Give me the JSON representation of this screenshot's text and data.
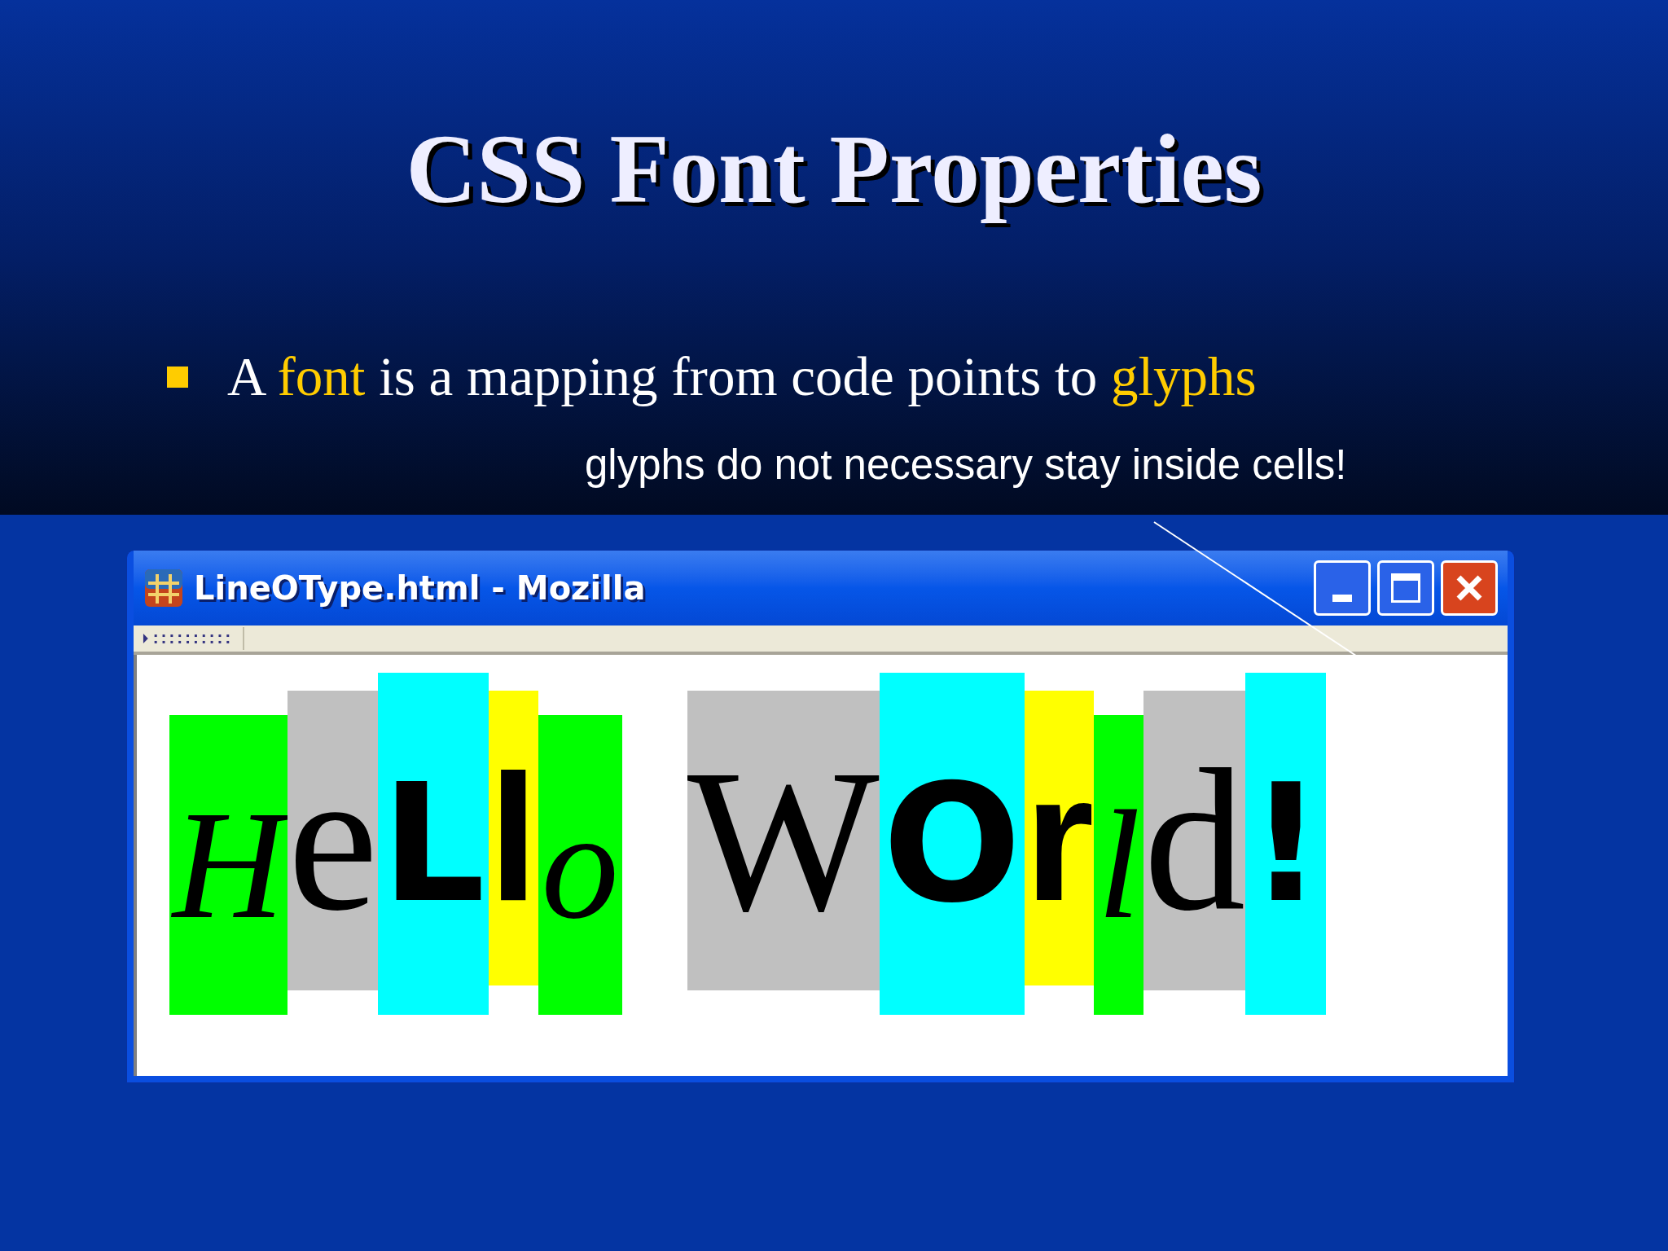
{
  "slide": {
    "title": "CSS Font Properties",
    "bullet": [
      {
        "text": "A ",
        "highlight": false
      },
      {
        "text": "font",
        "highlight": true
      },
      {
        "text": " is a mapping from code points to ",
        "highlight": false
      },
      {
        "text": "glyphs",
        "highlight": true
      }
    ],
    "annotation": "glyphs do not necessary stay inside cells!"
  },
  "window": {
    "title": "LineOType.html - Mozilla",
    "words": [
      {
        "cells": [
          {
            "glyph": "H",
            "kind": "script",
            "color": "#00ff00"
          },
          {
            "glyph": "e",
            "kind": "serif",
            "color": "#c0c0c0"
          },
          {
            "glyph": "L",
            "kind": "cartoon",
            "color": "#00ffff"
          },
          {
            "glyph": "l",
            "kind": "block",
            "color": "#ffff00"
          },
          {
            "glyph": "o",
            "kind": "script",
            "color": "#00ff00"
          }
        ]
      },
      {
        "cells": [
          {
            "glyph": "W",
            "kind": "serif",
            "color": "#c0c0c0"
          },
          {
            "glyph": "O",
            "kind": "cartoon",
            "color": "#00ffff"
          },
          {
            "glyph": "r",
            "kind": "block",
            "color": "#ffff00"
          },
          {
            "glyph": "l",
            "kind": "script",
            "color": "#00ff00"
          },
          {
            "glyph": "d",
            "kind": "serif",
            "color": "#c0c0c0"
          },
          {
            "glyph": "!",
            "kind": "cartoon",
            "color": "#00ffff"
          }
        ]
      }
    ]
  }
}
